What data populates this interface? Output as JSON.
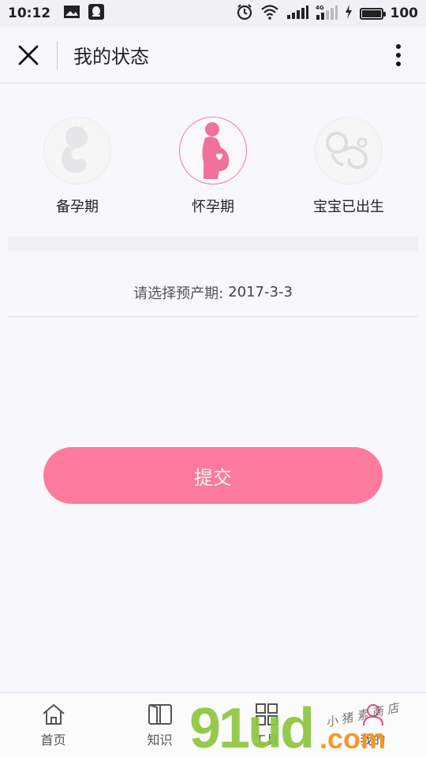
{
  "status_bar": {
    "time": "10:12",
    "battery": "100",
    "battery_level": 1.0,
    "left_icons": [
      "image-icon",
      "qq-icon"
    ],
    "right_icons": [
      "alarm-icon",
      "wifi-icon",
      "signal-icon",
      "signal-4g-icon",
      "charging-icon",
      "battery-icon"
    ]
  },
  "header": {
    "title": "我的状态"
  },
  "options": [
    {
      "label": "备孕期",
      "icon": "fetus-icon",
      "selected": false
    },
    {
      "label": "怀孕期",
      "icon": "pregnant-woman-icon",
      "selected": true
    },
    {
      "label": "宝宝已出生",
      "icon": "baby-icon",
      "selected": false
    }
  ],
  "due_date": {
    "label": "请选择预产期:",
    "value": "2017-3-3"
  },
  "submit": {
    "label": "提交"
  },
  "nav": [
    {
      "label": "首页",
      "icon": "home-icon"
    },
    {
      "label": "知识",
      "icon": "book-icon"
    },
    {
      "label": "工具",
      "icon": "grid-icon"
    },
    {
      "label": "我的",
      "icon": "user-icon"
    }
  ],
  "watermark": {
    "main": "91ud",
    "suffix": ".com",
    "handwriting": "小 猪 素 商 店"
  },
  "colors": {
    "accent": "#fe7a9d",
    "pink_icon": "#f0729a",
    "inactive_icon": "#e6e6e8"
  }
}
